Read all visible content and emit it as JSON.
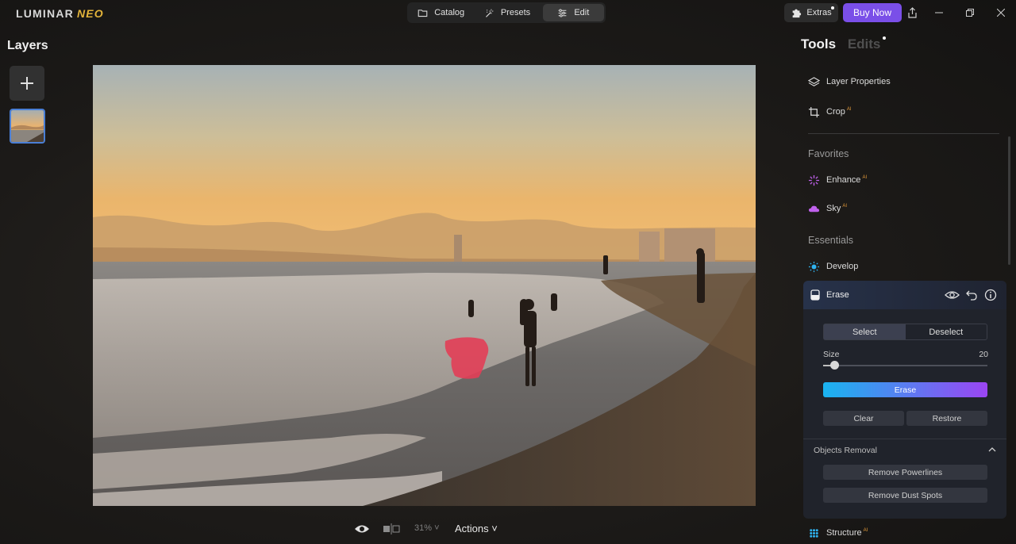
{
  "app": {
    "logo_main": "LUMINAR",
    "logo_sub": "NEO"
  },
  "topbar": {
    "modes": [
      {
        "label": "Catalog",
        "icon": "folder-icon"
      },
      {
        "label": "Presets",
        "icon": "magic-wand-icon"
      },
      {
        "label": "Edit",
        "icon": "sliders-icon",
        "active": true
      }
    ],
    "extras_label": "Extras",
    "buy_label": "Buy Now",
    "buy_color": "#7a4fe8"
  },
  "layers": {
    "title": "Layers"
  },
  "bottombar": {
    "zoom": "31%",
    "actions_label": "Actions"
  },
  "panel": {
    "tabs": [
      {
        "label": "Tools",
        "active": true
      },
      {
        "label": "Edits",
        "active": false
      }
    ],
    "top_tools": [
      {
        "label": "Layer Properties",
        "icon": "layers-icon"
      },
      {
        "label": "Crop",
        "icon": "crop-icon",
        "ai": "AI"
      }
    ],
    "favorites_title": "Favorites",
    "favorites": [
      {
        "label": "Enhance",
        "icon": "enhance-sparkle-icon",
        "ai": "AI"
      },
      {
        "label": "Sky",
        "icon": "cloud-icon",
        "ai": "AI"
      }
    ],
    "essentials_title": "Essentials",
    "essentials": [
      {
        "label": "Develop",
        "icon": "sun-icon"
      },
      {
        "label": "Structure",
        "icon": "structure-icon",
        "ai": "AI"
      }
    ],
    "erase": {
      "title": "Erase",
      "select_label": "Select",
      "deselect_label": "Deselect",
      "selected_mode": "Select",
      "size_label": "Size",
      "size_value": "20",
      "size_fraction": 0.07,
      "erase_label": "Erase",
      "clear_label": "Clear",
      "restore_label": "Restore",
      "objects_title": "Objects Removal",
      "remove_powerlines_label": "Remove Powerlines",
      "remove_dust_label": "Remove Dust Spots"
    }
  }
}
